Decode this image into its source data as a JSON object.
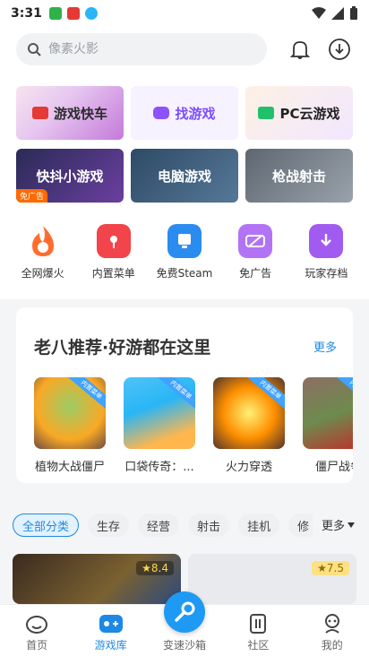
{
  "status": {
    "time": "3:31"
  },
  "search": {
    "placeholder": "像素火影"
  },
  "banners": [
    {
      "label": "游戏快车"
    },
    {
      "label": "找游戏"
    },
    {
      "label": "PC云游戏"
    },
    {
      "label": "快抖小游戏",
      "badge": "免广告"
    },
    {
      "label": "电脑游戏"
    },
    {
      "label": "枪战射击"
    }
  ],
  "shortcuts": [
    {
      "label": "全网爆火",
      "icon": "flame-icon"
    },
    {
      "label": "内置菜单",
      "icon": "menu-card-icon"
    },
    {
      "label": "免费Steam",
      "icon": "monitor-icon"
    },
    {
      "label": "免广告",
      "icon": "ad-block-icon"
    },
    {
      "label": "玩家存档",
      "icon": "folder-download-icon"
    }
  ],
  "recommend": {
    "title": "老八推荐·好游都在这里",
    "more": "更多",
    "ribbon": "内置菜单",
    "games": [
      {
        "name": "植物大战僵尸"
      },
      {
        "name": "口袋传奇：..."
      },
      {
        "name": "火力穿透"
      },
      {
        "name": "僵尸战争"
      }
    ]
  },
  "categories": {
    "chips": [
      "全部分类",
      "生存",
      "经营",
      "射击",
      "挂机",
      "修"
    ],
    "more": "更多"
  },
  "cards": [
    {
      "rating": "8.4"
    },
    {
      "rating": "7.5"
    }
  ],
  "tabs": [
    {
      "label": "首页"
    },
    {
      "label": "游戏库"
    },
    {
      "label": "变速沙箱"
    },
    {
      "label": "社区"
    },
    {
      "label": "我的"
    }
  ],
  "colors": {
    "accent": "#1e88e5",
    "fab": "#1e9af5"
  }
}
